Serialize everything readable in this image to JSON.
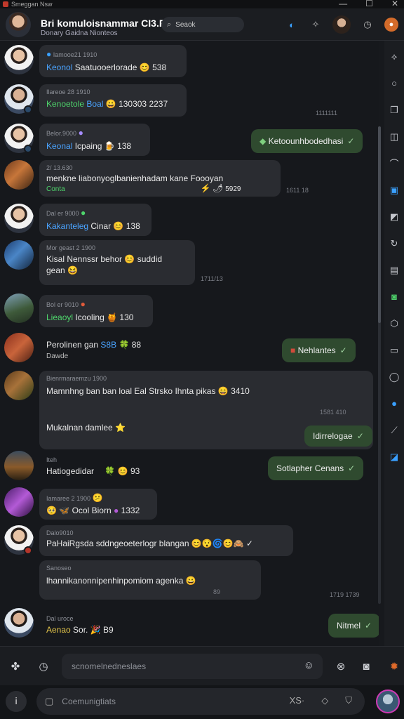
{
  "window": {
    "title": "Smeggan Nsw",
    "minimize": "—",
    "maximize": "☐",
    "close": "✕"
  },
  "header": {
    "title": "Bri komuloisnammar CI3.R",
    "subtitle": "Donary Gaidna Nionteos",
    "search_placeholder": "Seaok"
  },
  "messages": [
    {
      "meta": "Iamooe21 1910",
      "name": "Keonol",
      "text": "Saatuooerlorade",
      "emoji": "😊",
      "count": "538"
    },
    {
      "meta": "Ilareoe 28 1910",
      "name": "Kenoetole",
      "name2": "Boal",
      "emoji": "😀",
      "text": "130303 2237"
    },
    {
      "meta": "Belor.9000",
      "name": "Keonal",
      "text": "Icpaing",
      "emoji": "🍺",
      "count": "138"
    },
    {
      "meta": "2/ 13.630",
      "text": "menkne liabonyoglbanienhadam kane Foooyan",
      "name": "Conta",
      "emoji": "⚡",
      "emoji2": "🌶",
      "count": "5929"
    },
    {
      "meta": "Dal er 9000",
      "name": "Kakanteleg",
      "text": "Cinar",
      "emoji": "😊",
      "count": "138"
    },
    {
      "meta": "Mor geast 2 1900",
      "text": "Kisal Nennssr behor",
      "emoji": "😊",
      "text2": "suddid",
      "text3": "gean",
      "emoji2": "😆"
    },
    {
      "meta": "Bol er 9010",
      "name": "Lieaoyl",
      "text": "Icooling",
      "emoji": "🍯",
      "count": "130"
    },
    {
      "text": "Perolinen gan",
      "name": "S8B",
      "sub": "Dawde",
      "emoji": "🍀",
      "count": "88"
    },
    {
      "meta": "Bienrmaraemzu 1900",
      "text": "Mamnhng ban ban loal Eal Strsko Ihnta pikas",
      "emoji": "😄",
      "count": "3410",
      "text2": "Mukalnan damlee"
    },
    {
      "meta": "Iteh",
      "text": "Hatiogedidar",
      "emoji": "🍀",
      "emoji2": "😊",
      "count": "93"
    },
    {
      "meta": "Iamaree 2 1900",
      "emoji": "😕",
      "text": "Ocol",
      "text2": "Biorn",
      "count": "1332"
    },
    {
      "meta": "Dalo9010",
      "name": "PaHaiRgsda",
      "text": "sddngeoeterlogr blangan"
    },
    {
      "meta": "Sanoseo",
      "text": "lhannikanonnipenhinpomiom agenka",
      "emoji": "😀"
    },
    {
      "meta": "Dal uroce",
      "name": "Aenao",
      "text": "Sor.",
      "count": "B9"
    }
  ],
  "outgoing": [
    {
      "text": "Ketoounhbodedhasi"
    },
    {
      "text": "Nehlantes"
    },
    {
      "text": "Idirrelogae"
    },
    {
      "text": "Sotlapher Cenans"
    },
    {
      "text": "Nitmel"
    }
  ],
  "timestamps": [
    "1111111",
    "1611 18",
    "1711/13",
    "1581 410",
    "1719 1739",
    "89"
  ],
  "composer": {
    "placeholder": "scnomelnedneslaes"
  },
  "bottom": {
    "placeholder": "Coemunigtiats",
    "right_label": "XS·"
  }
}
